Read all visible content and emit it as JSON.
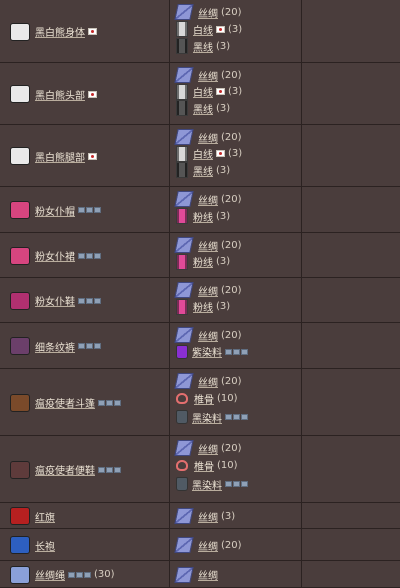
{
  "rows": [
    {
      "item": "黑白熊身体",
      "flag": true,
      "tags": false,
      "count": "",
      "ingredients": [
        {
          "name": "丝绸",
          "amount": "(20)",
          "icon": "silk-icon",
          "flag": false
        },
        {
          "name": "白线",
          "amount": "(3)",
          "icon": "white-thread-icon",
          "flag": true
        },
        {
          "name": "黑线",
          "amount": "(3)",
          "icon": "black-thread-icon",
          "flag": false
        }
      ]
    },
    {
      "item": "黑白熊头部",
      "flag": true,
      "tags": false,
      "count": "",
      "ingredients": [
        {
          "name": "丝绸",
          "amount": "(20)",
          "icon": "silk-icon",
          "flag": false
        },
        {
          "name": "白线",
          "amount": "(3)",
          "icon": "white-thread-icon",
          "flag": true
        },
        {
          "name": "黑线",
          "amount": "(3)",
          "icon": "black-thread-icon",
          "flag": false
        }
      ]
    },
    {
      "item": "黑白熊腿部",
      "flag": true,
      "tags": false,
      "count": "",
      "ingredients": [
        {
          "name": "丝绸",
          "amount": "(20)",
          "icon": "silk-icon",
          "flag": false
        },
        {
          "name": "白线",
          "amount": "(3)",
          "icon": "white-thread-icon",
          "flag": true
        },
        {
          "name": "黑线",
          "amount": "(3)",
          "icon": "black-thread-icon",
          "flag": false
        }
      ]
    },
    {
      "item": "粉女仆帽",
      "flag": false,
      "tags": true,
      "count": "",
      "ingredients": [
        {
          "name": "丝绸",
          "amount": "(20)",
          "icon": "silk-icon",
          "flag": false
        },
        {
          "name": "粉线",
          "amount": "(3)",
          "icon": "pink-thread-icon",
          "flag": false
        }
      ]
    },
    {
      "item": "粉女仆裙",
      "flag": false,
      "tags": true,
      "count": "",
      "ingredients": [
        {
          "name": "丝绸",
          "amount": "(20)",
          "icon": "silk-icon",
          "flag": false
        },
        {
          "name": "粉线",
          "amount": "(3)",
          "icon": "pink-thread-icon",
          "flag": false
        }
      ]
    },
    {
      "item": "粉女仆鞋",
      "flag": false,
      "tags": true,
      "count": "",
      "ingredients": [
        {
          "name": "丝绸",
          "amount": "(20)",
          "icon": "silk-icon",
          "flag": false
        },
        {
          "name": "粉线",
          "amount": "(3)",
          "icon": "pink-thread-icon",
          "flag": false
        }
      ]
    },
    {
      "item": "细条纹裤",
      "flag": false,
      "tags": true,
      "count": "",
      "ingredients": [
        {
          "name": "丝绸",
          "amount": "(20)",
          "icon": "silk-icon",
          "flag": false
        },
        {
          "name": "紫染料",
          "amount": "",
          "icon": "purple-dye-icon",
          "flag": false,
          "tags": true
        }
      ]
    },
    {
      "item": "瘟疫使者斗篷",
      "flag": false,
      "tags": true,
      "count": "",
      "ingredients": [
        {
          "name": "丝绸",
          "amount": "(20)",
          "icon": "silk-icon",
          "flag": false
        },
        {
          "name": "椎骨",
          "amount": "(10)",
          "icon": "vertebra-icon",
          "flag": false
        },
        {
          "name": "黑染料",
          "amount": "",
          "icon": "black-dye-icon",
          "flag": false,
          "tags": true
        }
      ]
    },
    {
      "item": "瘟疫使者便鞋",
      "flag": false,
      "tags": true,
      "count": "",
      "ingredients": [
        {
          "name": "丝绸",
          "amount": "(20)",
          "icon": "silk-icon",
          "flag": false
        },
        {
          "name": "椎骨",
          "amount": "(10)",
          "icon": "vertebra-icon",
          "flag": false
        },
        {
          "name": "黑染料",
          "amount": "",
          "icon": "black-dye-icon",
          "flag": false,
          "tags": true
        }
      ]
    },
    {
      "item": "红旗",
      "flag": false,
      "tags": false,
      "count": "",
      "ingredients": [
        {
          "name": "丝绸",
          "amount": "(3)",
          "icon": "silk-icon",
          "flag": false
        }
      ]
    },
    {
      "item": "长袍",
      "flag": false,
      "tags": false,
      "count": "",
      "ingredients": [
        {
          "name": "丝绸",
          "amount": "(20)",
          "icon": "silk-icon",
          "flag": false
        }
      ]
    },
    {
      "item": "丝绸绳",
      "flag": false,
      "tags": true,
      "count": "(30)",
      "ingredients": [
        {
          "name": "丝绸",
          "amount": "",
          "icon": "silk-icon",
          "flag": false
        }
      ]
    }
  ]
}
